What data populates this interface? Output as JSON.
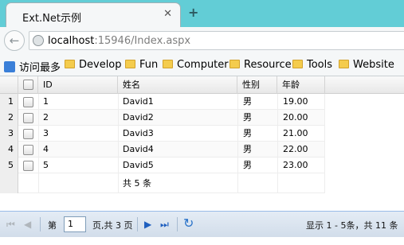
{
  "browser": {
    "tab_title": "Ext.Net示例",
    "tab_close": "✕",
    "new_tab": "+",
    "back": "←",
    "url_host": "localhost",
    "url_rest": ":15946/Index.aspx"
  },
  "bookmarks": [
    "访问最多",
    "Develop",
    "Fun",
    "Computer",
    "Resource",
    "Tools",
    "Website"
  ],
  "grid": {
    "headers": {
      "id": "ID",
      "name": "姓名",
      "gender": "性别",
      "age": "年龄"
    },
    "rows": [
      {
        "num": "1",
        "id": "1",
        "name": "David1",
        "gender": "男",
        "age": "19.00"
      },
      {
        "num": "2",
        "id": "2",
        "name": "David2",
        "gender": "男",
        "age": "20.00"
      },
      {
        "num": "3",
        "id": "3",
        "name": "David3",
        "gender": "男",
        "age": "21.00"
      },
      {
        "num": "4",
        "id": "4",
        "name": "David4",
        "gender": "男",
        "age": "22.00"
      },
      {
        "num": "5",
        "id": "5",
        "name": "David5",
        "gender": "男",
        "age": "23.00"
      }
    ],
    "summary": "共 5 条"
  },
  "pager": {
    "first": "⏮",
    "prev": "◀",
    "next": "▶",
    "last": "⏭",
    "refresh": "↻",
    "page_label": "第",
    "page_value": "1",
    "page_total": "页,共 3 页",
    "display_info": "显示 1 - 5条，共 11 条"
  }
}
